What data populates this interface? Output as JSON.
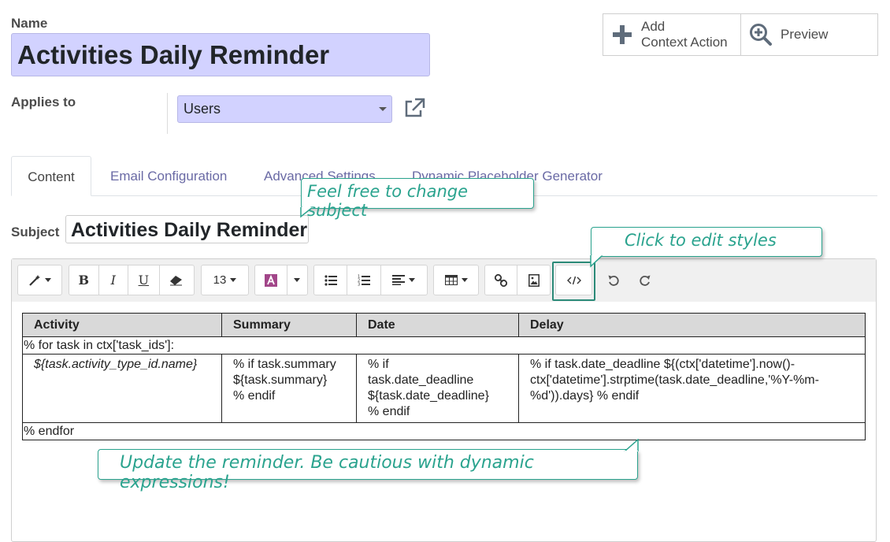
{
  "header": {
    "name_label": "Name",
    "name_value": "Activities Daily Reminder",
    "add_context_action_label_line1": "Add",
    "add_context_action_label_line2": "Context Action",
    "preview_label": "Preview"
  },
  "applies_to": {
    "label": "Applies to",
    "value": "Users"
  },
  "tabs": [
    {
      "label": "Content",
      "active": true
    },
    {
      "label": "Email Configuration",
      "active": false
    },
    {
      "label": "Advanced Settings",
      "active": false
    },
    {
      "label": "Dynamic Placeholder Generator",
      "active": false
    }
  ],
  "subject": {
    "label": "Subject",
    "value": "Activities Daily Reminder"
  },
  "toolbar": {
    "font_size": "13",
    "bold": "B",
    "italic": "I",
    "underline": "U"
  },
  "table": {
    "headers": [
      "Activity",
      "Summary",
      "Date",
      "Delay"
    ],
    "loop_start": "% for task in ctx['task_ids']:",
    "row": {
      "activity": "${task.activity_type_id.name}",
      "summary": [
        "% if task.summary",
        "${task.summary}",
        "% endif"
      ],
      "date": [
        "% if",
        "task.date_deadline",
        "${task.date_deadline}",
        "% endif"
      ],
      "delay": [
        "% if task.date_deadline ${(ctx['datetime'].now()-",
        "ctx['datetime'].strptime(task.date_deadline,'%Y-%m-",
        "%d')).days} % endif"
      ]
    },
    "loop_end": "% endfor"
  },
  "tips": {
    "subject_tip": "Feel free to change subject",
    "styles_tip": "Click to edit styles",
    "reminder_tip": "Update the reminder. Be cautious with dynamic expressions!"
  },
  "colors": {
    "field_bg": "#d2d2ff",
    "tip_accent": "#2aa38e",
    "tab_link": "#6a6aa5"
  }
}
